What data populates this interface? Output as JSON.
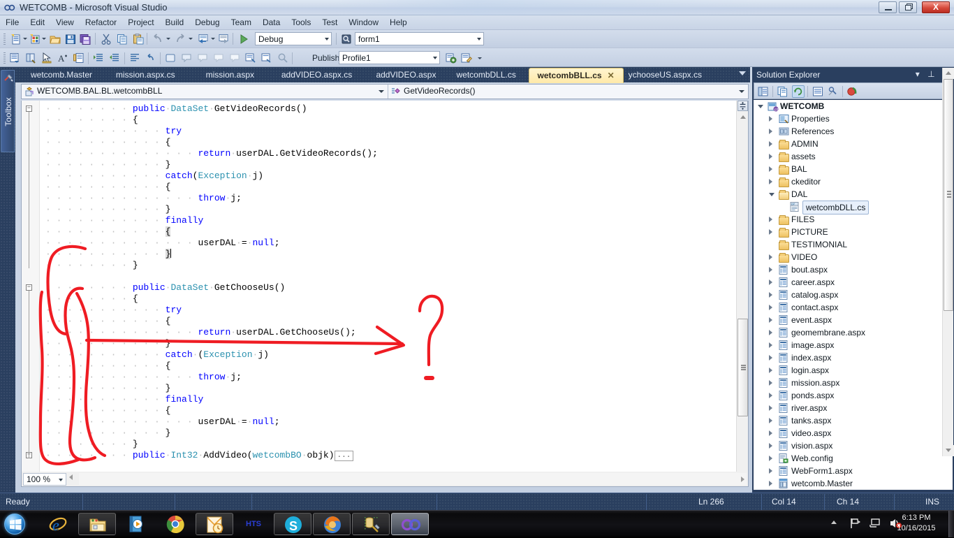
{
  "window": {
    "title": "WETCOMB - Microsoft Visual Studio",
    "minimize_label": "Minimize",
    "maximize_label": "Restore",
    "close_label": "X"
  },
  "menu": {
    "items": [
      "File",
      "Edit",
      "View",
      "Refactor",
      "Project",
      "Build",
      "Debug",
      "Team",
      "Data",
      "Tools",
      "Test",
      "Window",
      "Help"
    ]
  },
  "toolbar": {
    "config_combo": "Debug",
    "startup_combo": "form1",
    "publish_label": "Publish:",
    "publish_combo": "Profile1",
    "icons_row1": [
      "new-project-icon",
      "new-item-icon",
      "open-file-icon",
      "save-icon",
      "save-all-icon",
      "cut-icon",
      "copy-icon",
      "paste-icon",
      "undo-icon",
      "redo-icon",
      "navigate-backward-icon",
      "navigate-forward-icon",
      "start-debugging-icon"
    ],
    "icons_row2": [
      "solution-explorer-icon",
      "properties-window-icon",
      "pointer-icon",
      "font-icon",
      "document-outline-icon",
      "indent-icon",
      "outdent-icon",
      "format-icon",
      "undo-format-icon",
      "comment-icon",
      "uncomment-icon"
    ]
  },
  "toolbox": {
    "label": "Toolbox"
  },
  "tabs": {
    "items": [
      {
        "label": "wetcomb.Master",
        "active": false
      },
      {
        "label": "mission.aspx.cs",
        "active": false
      },
      {
        "label": "mission.aspx",
        "active": false
      },
      {
        "label": "addVIDEO.aspx.cs",
        "active": false
      },
      {
        "label": "addVIDEO.aspx",
        "active": false
      },
      {
        "label": "wetcombDLL.cs",
        "active": false
      },
      {
        "label": "wetcombBLL.cs",
        "active": true,
        "close": "✕"
      },
      {
        "label": "ychooseUS.aspx.cs",
        "active": false
      }
    ]
  },
  "navbar": {
    "class_combo": "WETCOMB.BAL.BL.wetcombBLL",
    "member_combo": "GetVideoRecords()"
  },
  "editor": {
    "zoom": "100 %",
    "lines": [
      {
        "indent": 0,
        "tokens": [
          {
            "t": "dots",
            "v": "· · · · · · · · "
          },
          {
            "t": "kw",
            "v": "public"
          },
          {
            "t": "dots",
            "v": "·"
          },
          {
            "t": "ty",
            "v": "DataSet"
          },
          {
            "t": "dots",
            "v": "·"
          },
          {
            "t": "id",
            "v": "GetVideoRecords()"
          }
        ],
        "fold": "minus"
      },
      {
        "indent": 0,
        "tokens": [
          {
            "t": "dots",
            "v": "· · · · · · · · "
          },
          {
            "t": "id",
            "v": "{"
          }
        ]
      },
      {
        "indent": 0,
        "tokens": [
          {
            "t": "dots",
            "v": "· · · · · · · · · · · "
          },
          {
            "t": "kw",
            "v": "try"
          }
        ]
      },
      {
        "indent": 0,
        "tokens": [
          {
            "t": "dots",
            "v": "· · · · · · · · · · · "
          },
          {
            "t": "id",
            "v": "{"
          }
        ]
      },
      {
        "indent": 0,
        "tokens": [
          {
            "t": "dots",
            "v": "· · · · · · · · · · · · · · "
          },
          {
            "t": "kw",
            "v": "return"
          },
          {
            "t": "dots",
            "v": "·"
          },
          {
            "t": "id",
            "v": "userDAL.GetVideoRecords();"
          }
        ]
      },
      {
        "indent": 0,
        "tokens": [
          {
            "t": "dots",
            "v": "· · · · · · · · · · · "
          },
          {
            "t": "id",
            "v": "}"
          }
        ]
      },
      {
        "indent": 0,
        "tokens": [
          {
            "t": "dots",
            "v": "· · · · · · · · · · · "
          },
          {
            "t": "kw",
            "v": "catch"
          },
          {
            "t": "id",
            "v": "("
          },
          {
            "t": "ty",
            "v": "Exception"
          },
          {
            "t": "dots",
            "v": "·"
          },
          {
            "t": "id",
            "v": "j)"
          }
        ]
      },
      {
        "indent": 0,
        "tokens": [
          {
            "t": "dots",
            "v": "· · · · · · · · · · · "
          },
          {
            "t": "id",
            "v": "{"
          }
        ]
      },
      {
        "indent": 0,
        "tokens": [
          {
            "t": "dots",
            "v": "· · · · · · · · · · · · · · "
          },
          {
            "t": "kw",
            "v": "throw"
          },
          {
            "t": "dots",
            "v": "·"
          },
          {
            "t": "id",
            "v": "j;"
          }
        ]
      },
      {
        "indent": 0,
        "tokens": [
          {
            "t": "dots",
            "v": "· · · · · · · · · · · "
          },
          {
            "t": "id",
            "v": "}"
          }
        ]
      },
      {
        "indent": 0,
        "tokens": [
          {
            "t": "dots",
            "v": "· · · · · · · · · · · "
          },
          {
            "t": "kw",
            "v": "finally"
          }
        ]
      },
      {
        "indent": 0,
        "tokens": [
          {
            "t": "dots",
            "v": "· · · · · · · · · · · "
          },
          {
            "t": "sel",
            "v": "{"
          }
        ]
      },
      {
        "indent": 0,
        "tokens": [
          {
            "t": "dots",
            "v": "· · · · · · · · · · · · · · "
          },
          {
            "t": "id",
            "v": "userDAL"
          },
          {
            "t": "dots",
            "v": "·"
          },
          {
            "t": "id",
            "v": "="
          },
          {
            "t": "dots",
            "v": "·"
          },
          {
            "t": "kw",
            "v": "null"
          },
          {
            "t": "id",
            "v": ";"
          }
        ]
      },
      {
        "indent": 0,
        "tokens": [
          {
            "t": "dots",
            "v": "· · · · · · · · · · · "
          },
          {
            "t": "sel",
            "v": "}"
          },
          {
            "t": "caret",
            "v": ""
          }
        ]
      },
      {
        "indent": 0,
        "tokens": [
          {
            "t": "dots",
            "v": "· · · · · · · · "
          },
          {
            "t": "id",
            "v": "}"
          }
        ]
      },
      {
        "indent": 0,
        "tokens": []
      },
      {
        "indent": 0,
        "tokens": [
          {
            "t": "dots",
            "v": "· · · · · · · · "
          },
          {
            "t": "kw",
            "v": "public"
          },
          {
            "t": "dots",
            "v": "·"
          },
          {
            "t": "ty",
            "v": "DataSet"
          },
          {
            "t": "dots",
            "v": "·"
          },
          {
            "t": "id",
            "v": "GetChooseUs()"
          }
        ],
        "fold": "minus"
      },
      {
        "indent": 0,
        "tokens": [
          {
            "t": "dots",
            "v": "· · · · · · · · "
          },
          {
            "t": "id",
            "v": "{"
          }
        ]
      },
      {
        "indent": 0,
        "tokens": [
          {
            "t": "dots",
            "v": "· · · · · · · · · · · "
          },
          {
            "t": "kw",
            "v": "try"
          }
        ]
      },
      {
        "indent": 0,
        "tokens": [
          {
            "t": "dots",
            "v": "· · · · · · · · · · · "
          },
          {
            "t": "id",
            "v": "{"
          }
        ]
      },
      {
        "indent": 0,
        "tokens": [
          {
            "t": "dots",
            "v": "· · · · · · · · · · · · · · "
          },
          {
            "t": "kw",
            "v": "return"
          },
          {
            "t": "dots",
            "v": "·"
          },
          {
            "t": "id",
            "v": "userDAL.GetChooseUs();"
          }
        ]
      },
      {
        "indent": 0,
        "tokens": [
          {
            "t": "dots",
            "v": "· · · · · · · · · · · "
          },
          {
            "t": "id",
            "v": "}"
          }
        ]
      },
      {
        "indent": 0,
        "tokens": [
          {
            "t": "dots",
            "v": "· · · · · · · · · · · "
          },
          {
            "t": "kw",
            "v": "catch"
          },
          {
            "t": "dots",
            "v": "·"
          },
          {
            "t": "id",
            "v": "("
          },
          {
            "t": "ty",
            "v": "Exception"
          },
          {
            "t": "dots",
            "v": "·"
          },
          {
            "t": "id",
            "v": "j)"
          }
        ]
      },
      {
        "indent": 0,
        "tokens": [
          {
            "t": "dots",
            "v": "· · · · · · · · · · · "
          },
          {
            "t": "id",
            "v": "{"
          }
        ]
      },
      {
        "indent": 0,
        "tokens": [
          {
            "t": "dots",
            "v": "· · · · · · · · · · · · · · "
          },
          {
            "t": "kw",
            "v": "throw"
          },
          {
            "t": "dots",
            "v": "·"
          },
          {
            "t": "id",
            "v": "j;"
          }
        ]
      },
      {
        "indent": 0,
        "tokens": [
          {
            "t": "dots",
            "v": "· · · · · · · · · · · "
          },
          {
            "t": "id",
            "v": "}"
          }
        ]
      },
      {
        "indent": 0,
        "tokens": [
          {
            "t": "dots",
            "v": "· · · · · · · · · · · "
          },
          {
            "t": "kw",
            "v": "finally"
          }
        ]
      },
      {
        "indent": 0,
        "tokens": [
          {
            "t": "dots",
            "v": "· · · · · · · · · · · "
          },
          {
            "t": "id",
            "v": "{"
          }
        ]
      },
      {
        "indent": 0,
        "tokens": [
          {
            "t": "dots",
            "v": "· · · · · · · · · · · · · · "
          },
          {
            "t": "id",
            "v": "userDAL"
          },
          {
            "t": "dots",
            "v": "·"
          },
          {
            "t": "id",
            "v": "="
          },
          {
            "t": "dots",
            "v": "·"
          },
          {
            "t": "kw",
            "v": "null"
          },
          {
            "t": "id",
            "v": ";"
          }
        ]
      },
      {
        "indent": 0,
        "tokens": [
          {
            "t": "dots",
            "v": "· · · · · · · · · · · "
          },
          {
            "t": "id",
            "v": "}"
          }
        ]
      },
      {
        "indent": 0,
        "tokens": [
          {
            "t": "dots",
            "v": "· · · · · · · · "
          },
          {
            "t": "id",
            "v": "}"
          }
        ]
      },
      {
        "indent": 0,
        "tokens": [
          {
            "t": "dots",
            "v": "· · · · · · · · "
          },
          {
            "t": "kw",
            "v": "public"
          },
          {
            "t": "dots",
            "v": "·"
          },
          {
            "t": "ty",
            "v": "Int32"
          },
          {
            "t": "dots",
            "v": "·"
          },
          {
            "t": "id",
            "v": "AddVideo("
          },
          {
            "t": "ty",
            "v": "wetcombBO"
          },
          {
            "t": "dots",
            "v": "·"
          },
          {
            "t": "id",
            "v": "objk)"
          },
          {
            "t": "box",
            "v": "..."
          }
        ],
        "fold": "plus"
      }
    ]
  },
  "solution_explorer": {
    "title": "Solution Explorer",
    "header_buttons": [
      "dropdown-icon",
      "pin-icon",
      "close-icon"
    ],
    "toolbar_icons": [
      "properties-icon",
      "show-all-files-icon",
      "refresh-icon",
      "view-code-icon",
      "view-designer-icon",
      "nuget-icon"
    ],
    "tree": [
      {
        "label": "WETCOMB",
        "depth": 0,
        "icon": "project-icon",
        "expander": "down",
        "bold": true
      },
      {
        "label": "Properties",
        "depth": 1,
        "icon": "properties-folder-icon",
        "expander": "right"
      },
      {
        "label": "References",
        "depth": 1,
        "icon": "references-icon",
        "expander": "right"
      },
      {
        "label": "ADMIN",
        "depth": 1,
        "icon": "folder-icon",
        "expander": "right"
      },
      {
        "label": "assets",
        "depth": 1,
        "icon": "folder-icon",
        "expander": "right"
      },
      {
        "label": "BAL",
        "depth": 1,
        "icon": "folder-icon",
        "expander": "right"
      },
      {
        "label": "ckeditor",
        "depth": 1,
        "icon": "folder-icon",
        "expander": "right"
      },
      {
        "label": "DAL",
        "depth": 1,
        "icon": "folder-open-icon",
        "expander": "down"
      },
      {
        "label": "wetcombDLL.cs",
        "depth": 2,
        "icon": "csharp-file-icon",
        "expander": "none",
        "selected": true
      },
      {
        "label": "FILES",
        "depth": 1,
        "icon": "folder-icon",
        "expander": "right"
      },
      {
        "label": "PICTURE",
        "depth": 1,
        "icon": "folder-icon",
        "expander": "right"
      },
      {
        "label": "TESTIMONIAL",
        "depth": 1,
        "icon": "folder-icon",
        "expander": "none"
      },
      {
        "label": "VIDEO",
        "depth": 1,
        "icon": "folder-icon",
        "expander": "right"
      },
      {
        "label": "bout.aspx",
        "depth": 1,
        "icon": "aspx-file-icon",
        "expander": "right"
      },
      {
        "label": "career.aspx",
        "depth": 1,
        "icon": "aspx-file-icon",
        "expander": "right"
      },
      {
        "label": "catalog.aspx",
        "depth": 1,
        "icon": "aspx-file-icon",
        "expander": "right"
      },
      {
        "label": "contact.aspx",
        "depth": 1,
        "icon": "aspx-file-icon",
        "expander": "right"
      },
      {
        "label": "event.aspx",
        "depth": 1,
        "icon": "aspx-file-icon",
        "expander": "right"
      },
      {
        "label": "geomembrane.aspx",
        "depth": 1,
        "icon": "aspx-file-icon",
        "expander": "right"
      },
      {
        "label": "image.aspx",
        "depth": 1,
        "icon": "aspx-file-icon",
        "expander": "right"
      },
      {
        "label": "index.aspx",
        "depth": 1,
        "icon": "aspx-file-icon",
        "expander": "right"
      },
      {
        "label": "login.aspx",
        "depth": 1,
        "icon": "aspx-file-icon",
        "expander": "right"
      },
      {
        "label": "mission.aspx",
        "depth": 1,
        "icon": "aspx-file-icon",
        "expander": "right"
      },
      {
        "label": "ponds.aspx",
        "depth": 1,
        "icon": "aspx-file-icon",
        "expander": "right"
      },
      {
        "label": "river.aspx",
        "depth": 1,
        "icon": "aspx-file-icon",
        "expander": "right"
      },
      {
        "label": "tanks.aspx",
        "depth": 1,
        "icon": "aspx-file-icon",
        "expander": "right"
      },
      {
        "label": "video.aspx",
        "depth": 1,
        "icon": "aspx-file-icon",
        "expander": "right"
      },
      {
        "label": "vision.aspx",
        "depth": 1,
        "icon": "aspx-file-icon",
        "expander": "right"
      },
      {
        "label": "Web.config",
        "depth": 1,
        "icon": "config-file-icon",
        "expander": "right"
      },
      {
        "label": "WebForm1.aspx",
        "depth": 1,
        "icon": "aspx-file-icon",
        "expander": "right"
      },
      {
        "label": "wetcomb.Master",
        "depth": 1,
        "icon": "master-page-icon",
        "expander": "right"
      }
    ]
  },
  "statusbar": {
    "ready": "Ready",
    "line": "Ln 266",
    "column": "Col 14",
    "character": "Ch 14",
    "insert_mode": "INS"
  },
  "taskbar": {
    "start": "start-orb-icon",
    "items": [
      "internet-explorer-icon",
      "windows-explorer-icon",
      "windows-media-player-icon",
      "google-chrome-icon",
      "microsoft-outlook-icon",
      "hts-icon",
      "skype-icon",
      "mozilla-firefox-icon",
      "sql-tools-icon",
      "visual-studio-icon"
    ],
    "hts_label": "HTS",
    "tray_icons": [
      "show-hidden-icons-icon",
      "network-flag-icon",
      "network-icon",
      "volume-muted-icon"
    ],
    "clock_time": "6:13 PM",
    "clock_date": "10/16/2015"
  },
  "annotations": {
    "color": "#ef1c23",
    "shapes": [
      "bracket-left-first-method",
      "bracket-left-second-method",
      "arrow-pointing-to-return-line",
      "question-mark"
    ]
  }
}
